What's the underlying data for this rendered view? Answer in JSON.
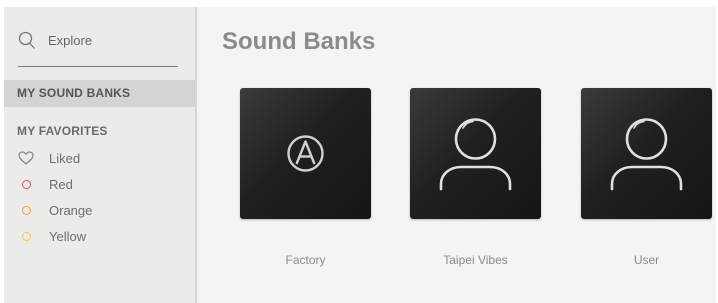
{
  "sidebar": {
    "search": {
      "label": "Explore",
      "icon": "search-icon"
    },
    "my_sound_banks": "MY SOUND BANKS",
    "favorites_heading": "MY FAVORITES",
    "favorites": [
      {
        "label": "Liked",
        "icon": "heart-icon",
        "color": "#8a8a8a"
      },
      {
        "label": "Red",
        "icon": "red-dot-icon",
        "color": "#e05757"
      },
      {
        "label": "Orange",
        "icon": "orange-dot-icon",
        "color": "#e8a34b"
      },
      {
        "label": "Yellow",
        "icon": "yellow-dot-icon",
        "color": "#e8d050"
      }
    ]
  },
  "main": {
    "title": "Sound Banks",
    "banks": [
      {
        "label": "Factory",
        "icon": "arturia-logo-icon"
      },
      {
        "label": "Taipei Vibes",
        "icon": "user-icon"
      },
      {
        "label": "User",
        "icon": "user-icon"
      }
    ]
  }
}
